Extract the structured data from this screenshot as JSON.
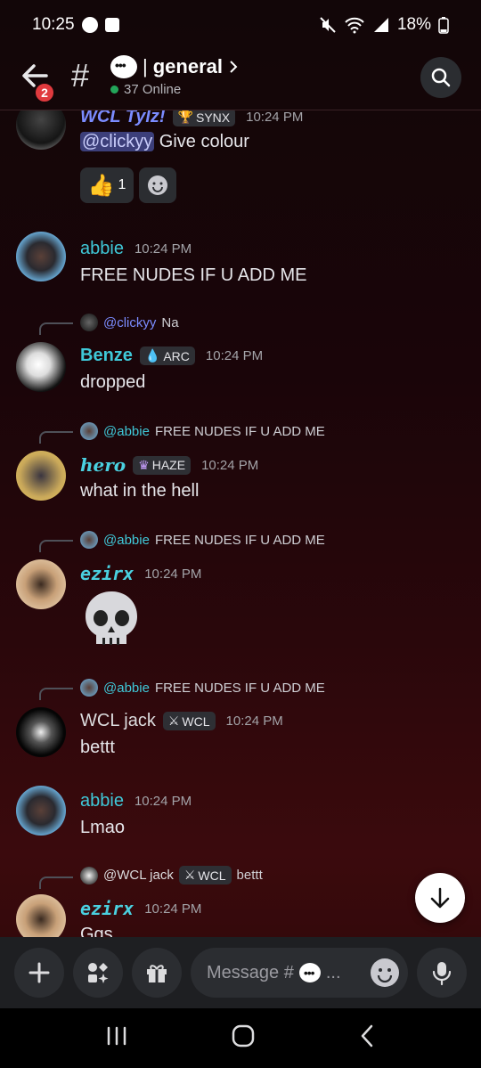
{
  "status_bar": {
    "time": "10:25",
    "battery": "18%"
  },
  "header": {
    "badge_count": "2",
    "channel_name": "general",
    "online_text": "37 Online"
  },
  "messages": [
    {
      "author": "WCL Tylz!",
      "tag": "SYNX",
      "time": "10:24 PM",
      "mention": "@clickyy",
      "text": " Give colour",
      "reaction_count": "1"
    },
    {
      "author": "abbie",
      "time": "10:24 PM",
      "text": "FREE NUDES IF U ADD ME"
    },
    {
      "reply_author": "@clickyy",
      "reply_text": "Na",
      "author": "Benze",
      "tag": "ARC",
      "time": "10:24 PM",
      "text": "dropped"
    },
    {
      "reply_author": "@abbie",
      "reply_text": "FREE NUDES IF U ADD ME",
      "author": "hero",
      "tag": "HAZE",
      "time": "10:24 PM",
      "text": "what in the hell"
    },
    {
      "reply_author": "@abbie",
      "reply_text": "FREE NUDES IF U ADD ME",
      "author": "ezirx",
      "time": "10:24 PM"
    },
    {
      "reply_author": "@abbie",
      "reply_text": "FREE NUDES IF U ADD ME",
      "author": "WCL jack",
      "tag": "WCL",
      "time": "10:24 PM",
      "text": "bettt"
    },
    {
      "author": "abbie",
      "time": "10:24 PM",
      "text": "Lmao"
    },
    {
      "reply_author": "@WCL jack",
      "reply_tag": "WCL",
      "reply_text": "bettt",
      "author": "ezirx",
      "time": "10:24 PM",
      "text": "Ggs"
    }
  ],
  "composer": {
    "placeholder": "Message #"
  },
  "colors": {
    "abbie": "#3fc8d8",
    "benze": "#3fc8d8",
    "hero": "#4ad0e0",
    "ezirx": "#4ad0e0",
    "tylz": "#7b8cff",
    "jack": "#dcdcde",
    "mention_bg": "#3c3f7a"
  }
}
